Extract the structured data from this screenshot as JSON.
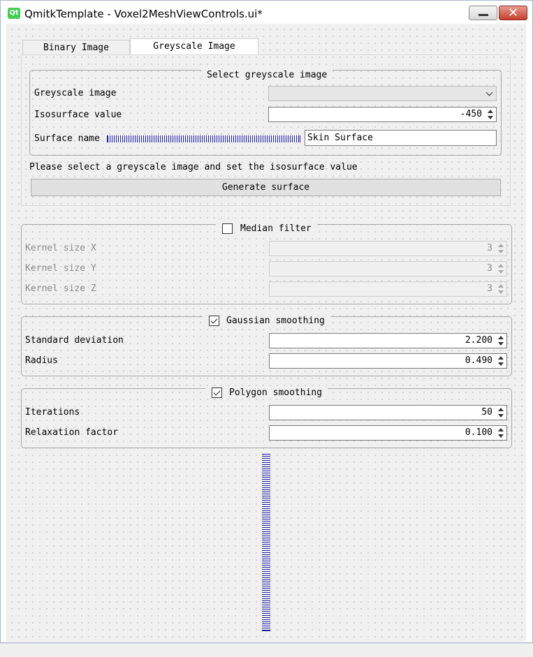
{
  "window": {
    "app_icon": "Qt",
    "title": "QmitkTemplate - Voxel2MeshViewControls.ui*",
    "buttons": [
      "minimize-icon",
      "close-icon"
    ]
  },
  "tabs": [
    {
      "label": "Binary Image",
      "active": false
    },
    {
      "label": "Greyscale Image",
      "active": true
    }
  ],
  "greyscale": {
    "group_title": "Select greyscale image",
    "greyscale_image_label": "Greyscale image",
    "greyscale_image_value": "",
    "isosurface_label": "Isosurface value",
    "isosurface_value": "-450",
    "surface_name_label": "Surface name",
    "surface_name_value": "Skin Surface",
    "hint": "Please select a greyscale image and set the isosurface value",
    "generate_button": "Generate surface"
  },
  "median": {
    "title": "Median filter",
    "checked": false,
    "fields": [
      {
        "label": "Kernel size X",
        "value": "3"
      },
      {
        "label": "Kernel size Y",
        "value": "3"
      },
      {
        "label": "Kernel size Z",
        "value": "3"
      }
    ]
  },
  "gaussian": {
    "title": "Gaussian smoothing",
    "checked": true,
    "fields": [
      {
        "label": "Standard deviation",
        "value": "2.200"
      },
      {
        "label": "Radius",
        "value": "0.490"
      }
    ]
  },
  "polygon": {
    "title": "Polygon smoothing",
    "checked": true,
    "fields": [
      {
        "label": "Iterations",
        "value": "50"
      },
      {
        "label": "Relaxation factor",
        "value": "0.100"
      }
    ]
  },
  "colors": {
    "spacer": "#1c1c9c",
    "close_button": "#c5402d",
    "qt_icon": "#41cd52"
  }
}
